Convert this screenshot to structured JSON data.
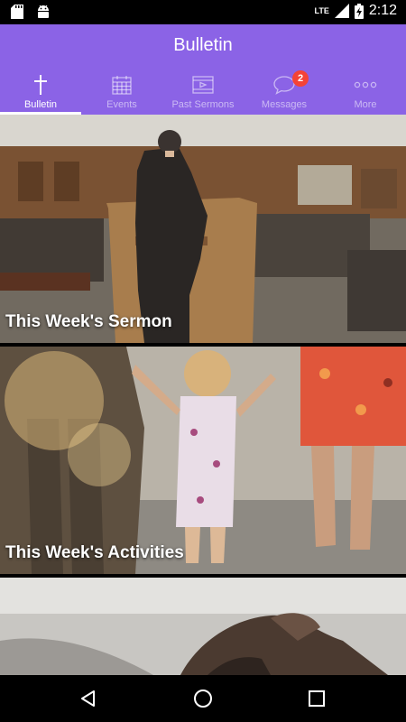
{
  "status_bar": {
    "network": "LTE",
    "time": "2:12"
  },
  "header": {
    "title": "Bulletin"
  },
  "tabs": [
    {
      "label": "Bulletin",
      "icon": "cross-icon",
      "active": true
    },
    {
      "label": "Events",
      "icon": "calendar-icon",
      "active": false
    },
    {
      "label": "Past Sermons",
      "icon": "video-icon",
      "active": false
    },
    {
      "label": "Messages",
      "icon": "chat-bubble-icon",
      "active": false,
      "badge": "2"
    },
    {
      "label": "More",
      "icon": "more-dots-icon",
      "active": false
    }
  ],
  "cards": [
    {
      "caption": "This Week's Sermon"
    },
    {
      "caption": "This Week's Activities"
    },
    {
      "caption": ""
    }
  ],
  "colors": {
    "header": "#8b63e6",
    "badge": "#f44336"
  }
}
